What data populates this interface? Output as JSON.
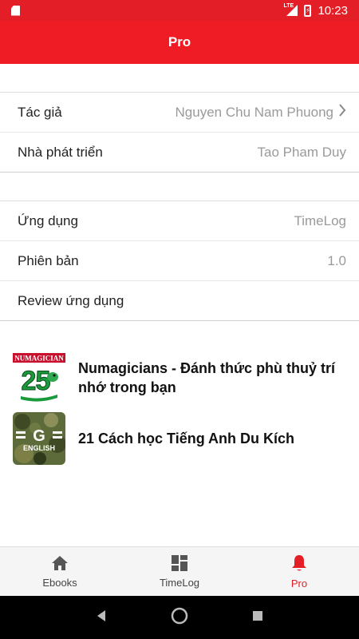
{
  "status_bar": {
    "network": "LTE",
    "time": "10:23"
  },
  "app_bar": {
    "title": "Pro"
  },
  "info": {
    "author_label": "Tác giả",
    "author_value": "Nguyen Chu Nam Phuong",
    "developer_label": "Nhà phát triển",
    "developer_value": "Tao Pham Duy",
    "app_label": "Ứng dụng",
    "app_value": "TimeLog",
    "version_label": "Phiên bản",
    "version_value": "1.0",
    "review_label": "Review ứng dụng"
  },
  "promos": [
    {
      "title": "Numagicians - Đánh thức phù thuỷ trí nhớ trong bạn",
      "logo_text": "NUMAGICIAN",
      "icon": "numagicians-logo-icon"
    },
    {
      "title": "21 Cách học Tiếng Anh Du Kích",
      "logo_text": "ENGLISH",
      "icon": "english-logo-icon"
    }
  ],
  "bottom_nav": [
    {
      "label": "Ebooks",
      "icon": "home-icon"
    },
    {
      "label": "TimeLog",
      "icon": "dashboard-icon"
    },
    {
      "label": "Pro",
      "icon": "bell-icon",
      "active": true
    }
  ],
  "colors": {
    "accent": "#ef1c25",
    "value_gray": "#9a9a9a"
  }
}
